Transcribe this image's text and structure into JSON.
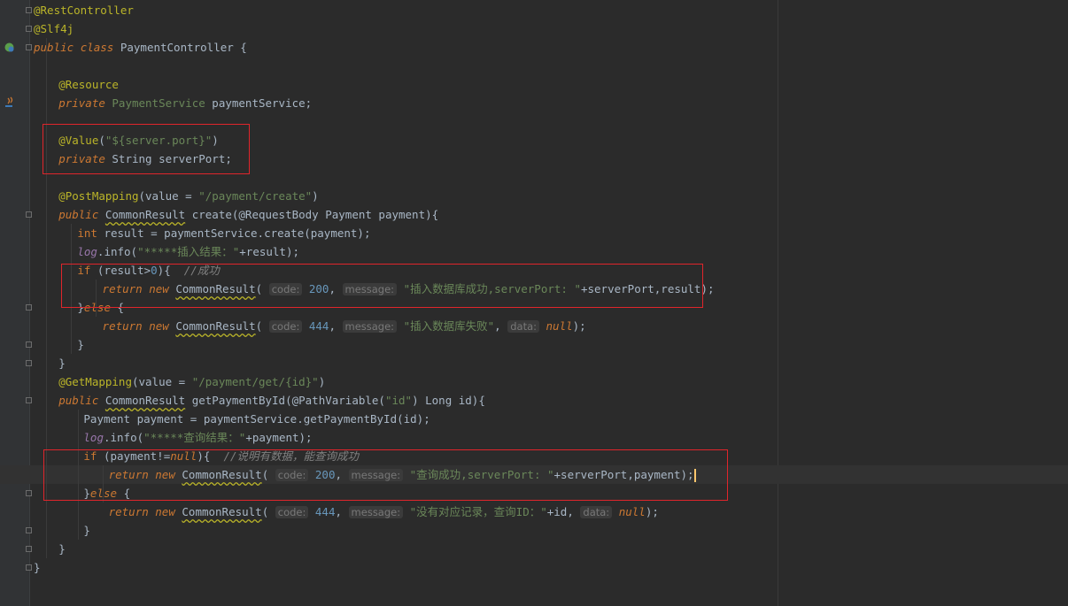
{
  "editor": {
    "lines": [
      {
        "indent": 0,
        "tokens": [
          [
            "ann",
            "@RestController"
          ]
        ]
      },
      {
        "indent": 0,
        "tokens": [
          [
            "ann",
            "@Slf4j"
          ]
        ]
      },
      {
        "indent": 0,
        "tokens": [
          [
            "kwi",
            "public "
          ],
          [
            "kwi",
            "class "
          ],
          [
            "cls",
            "PaymentController {"
          ]
        ]
      },
      {
        "indent": 0,
        "tokens": []
      },
      {
        "indent": 4,
        "tokens": [
          [
            "ann",
            "@Resource"
          ]
        ]
      },
      {
        "indent": 4,
        "tokens": [
          [
            "kwi",
            "private "
          ],
          [
            "iface",
            "PaymentService"
          ],
          [
            "plain",
            " paymentService;"
          ]
        ]
      },
      {
        "indent": 0,
        "tokens": []
      },
      {
        "indent": 4,
        "tokens": [
          [
            "ann",
            "@Value"
          ],
          [
            "plain",
            "("
          ],
          [
            "str",
            "\"${server.port}\""
          ],
          [
            "plain",
            ")"
          ]
        ]
      },
      {
        "indent": 4,
        "tokens": [
          [
            "kwi",
            "private "
          ],
          [
            "typ",
            "String "
          ],
          [
            "plain",
            "serverPort;"
          ]
        ]
      },
      {
        "indent": 0,
        "tokens": []
      },
      {
        "indent": 4,
        "tokens": [
          [
            "ann",
            "@PostMapping"
          ],
          [
            "plain",
            "(value = "
          ],
          [
            "str",
            "\"/payment/create\""
          ],
          [
            "plain",
            ")"
          ]
        ]
      },
      {
        "indent": 4,
        "tokens": [
          [
            "kwi",
            "public "
          ],
          [
            "warn",
            "CommonResult"
          ],
          [
            "plain",
            " create(@RequestBody Payment payment){"
          ]
        ]
      },
      {
        "indent": 7,
        "tokens": [
          [
            "kw",
            "int "
          ],
          [
            "plain",
            "result = paymentService.create(payment);"
          ]
        ]
      },
      {
        "indent": 7,
        "tokens": [
          [
            "fldi",
            "log"
          ],
          [
            "plain",
            ".info("
          ],
          [
            "str",
            "\"*****插入结果：\""
          ],
          [
            "plain",
            "+result);"
          ]
        ]
      },
      {
        "indent": 7,
        "tokens": [
          [
            "kw",
            "if "
          ],
          [
            "plain",
            "(result>"
          ],
          [
            "num",
            "0"
          ],
          [
            "plain",
            "){  "
          ],
          [
            "cm",
            "//成功"
          ]
        ]
      },
      {
        "indent": 11,
        "tokens": [
          [
            "kwi",
            "return "
          ],
          [
            "kwi",
            "new "
          ],
          [
            "warn",
            "CommonResult"
          ],
          [
            "plain",
            "( "
          ],
          [
            "hint",
            "code:"
          ],
          [
            "plain",
            " "
          ],
          [
            "num",
            "200"
          ],
          [
            "plain",
            ", "
          ],
          [
            "hint",
            "message:"
          ],
          [
            "plain",
            " "
          ],
          [
            "str",
            "\"插入数据库成功,serverPort: \""
          ],
          [
            "plain",
            "+serverPort,result);"
          ]
        ]
      },
      {
        "indent": 7,
        "tokens": [
          [
            "plain",
            "}"
          ],
          [
            "kwi",
            "else "
          ],
          [
            "plain",
            "{"
          ]
        ]
      },
      {
        "indent": 11,
        "tokens": [
          [
            "kwi",
            "return "
          ],
          [
            "kwi",
            "new "
          ],
          [
            "warn",
            "CommonResult"
          ],
          [
            "plain",
            "( "
          ],
          [
            "hint",
            "code:"
          ],
          [
            "plain",
            " "
          ],
          [
            "num",
            "444"
          ],
          [
            "plain",
            ", "
          ],
          [
            "hint",
            "message:"
          ],
          [
            "plain",
            " "
          ],
          [
            "str",
            "\"插入数据库失败\""
          ],
          [
            "plain",
            ", "
          ],
          [
            "hint",
            "data:"
          ],
          [
            "plain",
            " "
          ],
          [
            "kwi",
            "null"
          ],
          [
            "plain",
            ");"
          ]
        ]
      },
      {
        "indent": 7,
        "tokens": [
          [
            "plain",
            "}"
          ]
        ]
      },
      {
        "indent": 4,
        "tokens": [
          [
            "plain",
            "}"
          ]
        ]
      },
      {
        "indent": 4,
        "tokens": [
          [
            "ann",
            "@GetMapping"
          ],
          [
            "plain",
            "(value = "
          ],
          [
            "str",
            "\"/payment/get/{id}\""
          ],
          [
            "plain",
            ")"
          ]
        ]
      },
      {
        "indent": 4,
        "tokens": [
          [
            "kwi",
            "public "
          ],
          [
            "warn",
            "CommonResult"
          ],
          [
            "plain",
            " getPaymentById(@PathVariable("
          ],
          [
            "str",
            "\"id\""
          ],
          [
            "plain",
            ") Long id){"
          ]
        ]
      },
      {
        "indent": 8,
        "tokens": [
          [
            "plain",
            "Payment payment = paymentService.getPaymentById(id);"
          ]
        ]
      },
      {
        "indent": 8,
        "tokens": [
          [
            "fldi",
            "log"
          ],
          [
            "plain",
            ".info("
          ],
          [
            "str",
            "\"*****查询结果：\""
          ],
          [
            "plain",
            "+payment);"
          ]
        ]
      },
      {
        "indent": 8,
        "tokens": [
          [
            "kw",
            "if "
          ],
          [
            "plain",
            "(payment!="
          ],
          [
            "kwi",
            "null"
          ],
          [
            "plain",
            "){  "
          ],
          [
            "cm",
            "//说明有数据，能查询成功"
          ]
        ]
      },
      {
        "indent": 12,
        "tokens": [
          [
            "kwi",
            "return "
          ],
          [
            "kwi",
            "new "
          ],
          [
            "warn",
            "CommonResult"
          ],
          [
            "plain",
            "( "
          ],
          [
            "hint",
            "code:"
          ],
          [
            "plain",
            " "
          ],
          [
            "num",
            "200"
          ],
          [
            "plain",
            ", "
          ],
          [
            "hint",
            "message:"
          ],
          [
            "plain",
            " "
          ],
          [
            "str",
            "\"查询成功,serverPort: \""
          ],
          [
            "plain",
            "+serverPort,payment);"
          ],
          [
            "caret",
            ""
          ]
        ]
      },
      {
        "indent": 8,
        "tokens": [
          [
            "plain",
            "}"
          ],
          [
            "kwi",
            "else "
          ],
          [
            "plain",
            "{"
          ]
        ]
      },
      {
        "indent": 12,
        "tokens": [
          [
            "kwi",
            "return "
          ],
          [
            "kwi",
            "new "
          ],
          [
            "warn",
            "CommonResult"
          ],
          [
            "plain",
            "( "
          ],
          [
            "hint",
            "code:"
          ],
          [
            "plain",
            " "
          ],
          [
            "num",
            "444"
          ],
          [
            "plain",
            ", "
          ],
          [
            "hint",
            "message:"
          ],
          [
            "plain",
            " "
          ],
          [
            "str",
            "\"没有对应记录，查询ID：\""
          ],
          [
            "plain",
            "+id, "
          ],
          [
            "hint",
            "data:"
          ],
          [
            "plain",
            " "
          ],
          [
            "kwi",
            "null"
          ],
          [
            "plain",
            ");"
          ]
        ]
      },
      {
        "indent": 8,
        "tokens": [
          [
            "plain",
            "}"
          ]
        ]
      },
      {
        "indent": 4,
        "tokens": [
          [
            "plain",
            "}"
          ]
        ]
      },
      {
        "indent": 0,
        "tokens": [
          [
            "plain",
            "}"
          ]
        ]
      }
    ],
    "current_line": 25
  }
}
